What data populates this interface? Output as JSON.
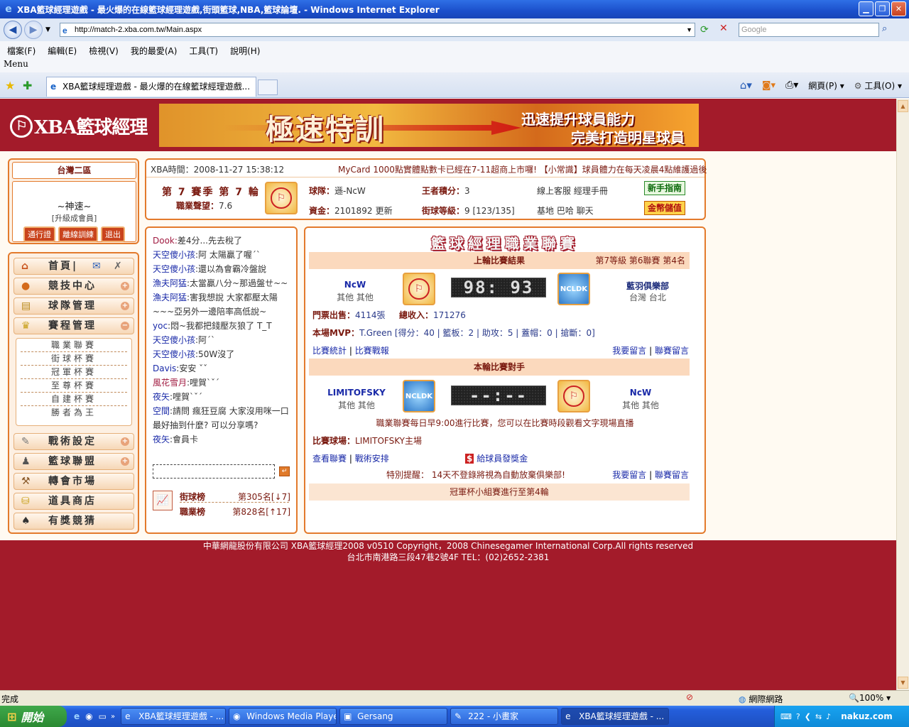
{
  "window": {
    "title": "XBA籃球經理遊戲 - 最火爆的在線籃球經理遊戲,街頭籃球,NBA,籃球論壇. - Windows Internet Explorer",
    "address": "http://match-2.xba.com.tw/Main.aspx",
    "search_placeholder": "Google",
    "menu": [
      "檔案(F)",
      "編輯(E)",
      "檢視(V)",
      "我的最愛(A)",
      "工具(T)",
      "說明(H)"
    ],
    "menu_label": "Menu",
    "tab_title": "XBA籃球經理遊戲 - 最火爆的在線籃球經理遊戲...",
    "toolbar": {
      "page": "網頁(P)",
      "tools": "工具(O)"
    }
  },
  "header": {
    "logo": "XBA籃球經理",
    "banner_main": "極速特訓",
    "banner_line1": "迅速提升球員能力",
    "banner_line2": "完美打造明星球員"
  },
  "sidebar": {
    "region": "台灣二區",
    "username": "~神速~",
    "upgrade": "[升級成會員]",
    "buttons": [
      "通行證",
      "離線訓練",
      "退出"
    ],
    "nav": [
      "首頁|",
      "競技中心",
      "球隊管理",
      "賽程管理",
      "戰術設定",
      "籃球聯盟",
      "轉會市場",
      "道具商店",
      "有獎競猜"
    ],
    "sub_nav": [
      "職業聯賽",
      "街球杯賽",
      "冠軍杯賽",
      "至尊杯賽",
      "自建杯賽",
      "勝者為王"
    ]
  },
  "info": {
    "time_label": "XBA時間：",
    "time": "2008-11-27 15:38:12",
    "ticker": "MyCard 1000點實體點數卡已經在7-11超商上市囉! 【小常識】球員體力在每天凌晨4點維護過後",
    "season": "第 7 賽季 第 7 輪",
    "rating_label": "職業聲望：",
    "rating": "7.6",
    "team_label": "球隊：",
    "team": "遜-NcW",
    "king_label": "王者積分：",
    "king": "3",
    "online": "線上客服 經理手冊",
    "funds_label": "資金：",
    "funds": "2101892",
    "update": "更新",
    "street_label": "街球等級：",
    "street": "9 [123/135]",
    "base": "基地 巴哈 聊天",
    "guide_btn": "新手指南",
    "gold_btn": "金幣儲值"
  },
  "chat": {
    "messages": [
      {
        "user": "Dook:",
        "text": "差4分...先去稅了",
        "c": "u2"
      },
      {
        "user": "天空傻小孩",
        "text": ":阿 太陽贏了喔ˊˋ",
        "c": "u"
      },
      {
        "user": "天空傻小孩",
        "text": ":還以為會霸冷盤說",
        "c": "u"
      },
      {
        "user": "漁夫阿猛",
        "text": ":太當贏八分~那過盤ㄝ~~",
        "c": "u"
      },
      {
        "user": "漁夫阿猛",
        "text": ":害我想說 大家都壓太陽~~~亞另外一邊陪率高低說~",
        "c": "u"
      },
      {
        "user": "yoc",
        "text": ":悶~我都把錢壓灰狼了 T_T",
        "c": "u"
      },
      {
        "user": "天空傻小孩",
        "text": ":阿ˊˋ",
        "c": "u"
      },
      {
        "user": "天空傻小孩",
        "text": ":50W沒了",
        "c": "u"
      },
      {
        "user": "Davis",
        "text": ":安安 ˇˇ",
        "c": "u"
      },
      {
        "user": "風花雪月",
        "text": ":哩賀ˋˇˊ",
        "c": "u2"
      },
      {
        "user": "夜矢",
        "text": ":哩賀ˋˇˊ",
        "c": "u"
      },
      {
        "user": "空間",
        "text": ":請問 瘋狂豆腐 大家沒用咪一口最好抽到什麼? 可以分享嗎?",
        "c": "u"
      },
      {
        "user": "夜矢",
        "text": ":會員卡",
        "c": "u"
      }
    ],
    "rank1_label": "街球榜",
    "rank1": "第305名[↓7]",
    "rank2_label": "職業榜",
    "rank2": "第828名[↑17]"
  },
  "game": {
    "title": "籃球經理職業聯賽",
    "last_title": "上輪比賽結果",
    "last_info": "第7等級 第6聯賽 第4名",
    "home": "NcW",
    "home_sub": "其他 其他",
    "score": "98: 93",
    "away": "藍羽俱樂部",
    "away_sub": "台灣 台北",
    "tickets_label": "門票出售：",
    "tickets": "4114張",
    "income_label": "總收入：",
    "income": "171276",
    "mvp_label": "本場MVP：",
    "mvp": "T.Green [得分：40 | 籃板：2 | 助攻：5 | 蓋帽：0 | 搶斷：0]",
    "links1": [
      "比賽統計",
      "比賽戰報"
    ],
    "links_msg": [
      "我要留言",
      "聯賽留言"
    ],
    "next_title": "本輪比賽對手",
    "opp": "LIMITOFSKY",
    "opp_sub": "其他 其他",
    "next_score": "--:--",
    "me": "NcW",
    "me_sub": "其他 其他",
    "notice": "職業聯賽每日早9:00進行比賽，您可以在比賽時段觀看文字現場直播",
    "venue_label": "比賽球場：",
    "venue": "LIMITOFSKY主場",
    "links2": [
      "查看聯賽",
      "戰術安排"
    ],
    "bonus": "給球員發獎金",
    "remind": "特別提醒： 14天不登錄將視為自動放棄俱樂部!",
    "footer_bar": "冠軍杯小組賽進行至第4輪",
    "horse_text": "NCLDK"
  },
  "footer": {
    "line1": "中華網龍股份有限公司 XBA籃球經理2008 v0510 Copyright，2008 Chinesegamer International Corp.All rights reserved",
    "line2": "台北市南港路三段47巷2號4F TEL：(02)2652-2381"
  },
  "status": {
    "left": "完成",
    "zone": "網際網路",
    "zoom": "100%"
  },
  "taskbar": {
    "start": "開始",
    "tasks": [
      "XBA籃球經理遊戲 - ...",
      "Windows Media Player",
      "Gersang",
      "222 - 小畫家",
      "XBA籃球經理遊戲 - ..."
    ],
    "watermark": "nakuz.com"
  },
  "colors": {
    "page_bg": "#a31b2a",
    "panel_border": "#e37a2c",
    "link": "#1a2aa8"
  }
}
